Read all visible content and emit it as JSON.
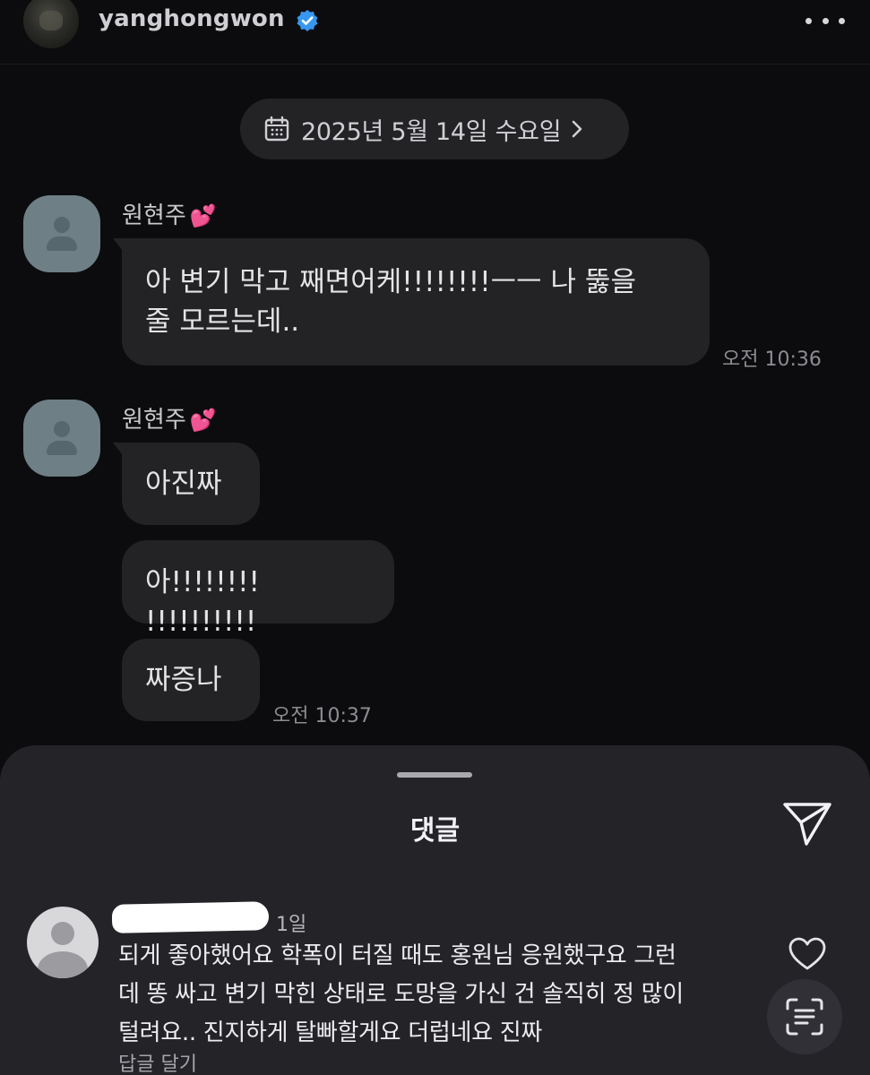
{
  "header": {
    "username": "yanghongwon",
    "verified": true
  },
  "chat": {
    "date_label": "2025년 5월 14일 수요일",
    "groups": [
      {
        "sender": "원현주",
        "sender_emoji": "💕",
        "messages": [
          {
            "line1": "아 변기 막고 째면어케!!!!!!!!ㅡㅡ 나 뚫을",
            "line2": "줄 모르는데.."
          }
        ],
        "time": "오전 10:36"
      },
      {
        "sender": "원현주",
        "sender_emoji": "💕",
        "messages": [
          {
            "text": "아진짜"
          },
          {
            "text": "아!!!!!!!! !!!!!!!!!!"
          },
          {
            "text": "짜증나"
          }
        ],
        "time": "오전 10:37"
      }
    ]
  },
  "comments_sheet": {
    "title": "댓글",
    "comment": {
      "age": "1일",
      "line1": "되게 좋아했어요 학폭이 터질 때도 홍원님 응원했구요 그런",
      "line2": "데 똥 싸고 변기 막힌 상태로 도망을 가신 건 솔직히 정 많이",
      "line3": "털려요.. 진지하게 탈빠할게요 더럽네요 진짜",
      "reply_label": "답글 달기"
    }
  },
  "colors": {
    "background": "#0c0c0e",
    "bubble": "#232326",
    "sheet": "#242428",
    "verified_badge": "#3797f0",
    "heart_emoji": "#ec5fa7"
  },
  "icons": [
    "verified-badge-icon",
    "more-options-icon",
    "calendar-icon",
    "chevron-right-icon",
    "send-icon",
    "heart-icon",
    "scan-text-icon"
  ]
}
